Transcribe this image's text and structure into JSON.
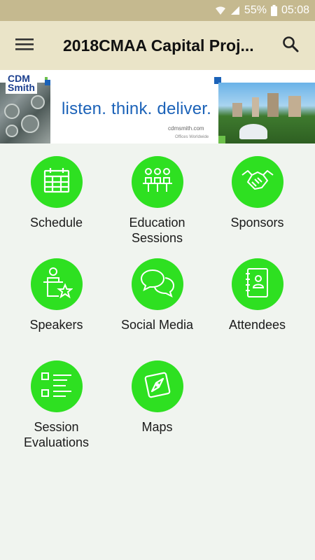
{
  "status_bar": {
    "battery_percent": "55%",
    "time": "05:08",
    "icons": [
      "wifi-icon",
      "signal-icon",
      "battery-icon"
    ]
  },
  "app_bar": {
    "title": "2018CMAA Capital Proj...",
    "menu_icon": "hamburger-menu-icon",
    "search_icon": "search-icon"
  },
  "banner": {
    "logo_text": "CDM Smith",
    "tagline": "listen. think. deliver.",
    "url": "cdmsmith.com",
    "footnote": "Offices Worldwide"
  },
  "tiles": [
    {
      "label": "Schedule",
      "icon": "calendar-icon"
    },
    {
      "label": "Education\nSessions",
      "icon": "group-presentation-icon"
    },
    {
      "label": "Sponsors",
      "icon": "handshake-icon"
    },
    {
      "label": "Speakers",
      "icon": "speaker-podium-icon"
    },
    {
      "label": "Social Media",
      "icon": "chat-bubbles-icon"
    },
    {
      "label": "Attendees",
      "icon": "address-book-icon"
    },
    {
      "label": "Session\nEvaluations",
      "icon": "checklist-icon"
    },
    {
      "label": "Maps",
      "icon": "compass-icon"
    }
  ],
  "colors": {
    "status_bar": "#c5b98f",
    "app_bar": "#eae4c8",
    "tile_circle": "#2ee021",
    "background": "#f0f4ef"
  }
}
